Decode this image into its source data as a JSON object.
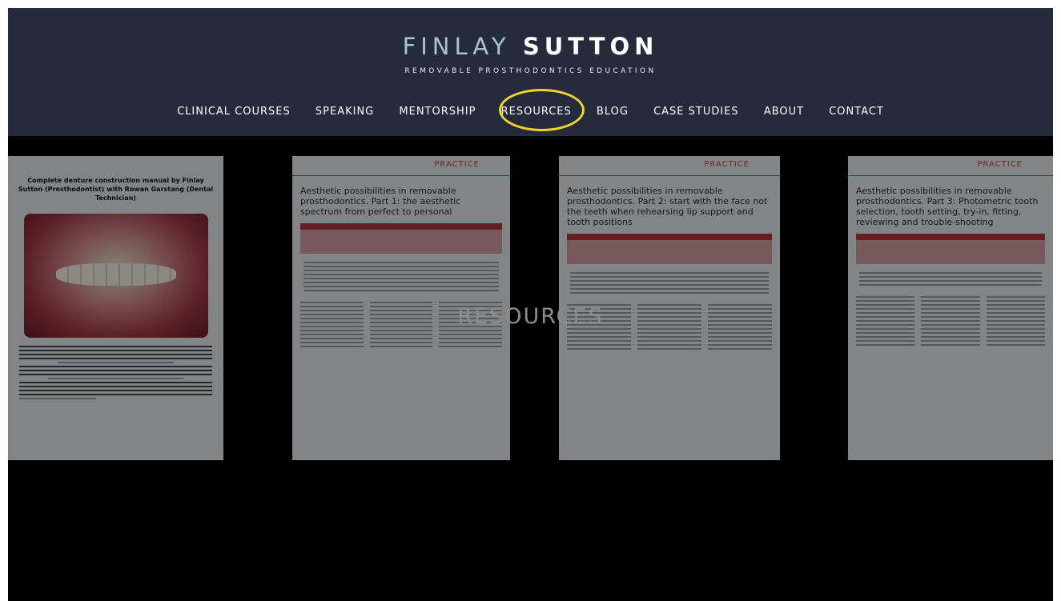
{
  "logo": {
    "first": "FINLAY",
    "last": "SUTTON"
  },
  "tagline": "REMOVABLE PROSTHODONTICS EDUCATION",
  "nav": [
    "CLINICAL COURSES",
    "SPEAKING",
    "MENTORSHIP",
    "RESOURCES",
    "BLOG",
    "CASE STUDIES",
    "ABOUT",
    "CONTACT"
  ],
  "highlight_color": "#f2d42a",
  "hero_title": "RESOURCES",
  "documents": [
    {
      "title": "Complete denture construction manual by Finlay Sutton (Prosthodontist) with Rowan Garstang (Dental Technician)"
    },
    {
      "tag": "PRACTICE",
      "title": "Aesthetic possibilities in removable prosthodontics. Part 1: the aesthetic spectrum from perfect to personal"
    },
    {
      "tag": "PRACTICE",
      "title": "Aesthetic possibilities in removable prosthodontics. Part 2: start with the face not the teeth when rehearsing lip support and tooth positions"
    },
    {
      "tag": "PRACTICE",
      "title": "Aesthetic possibilities in removable prosthodontics. Part 3: Photometric tooth selection, tooth setting, try-in, fitting, reviewing and trouble-shooting"
    }
  ]
}
